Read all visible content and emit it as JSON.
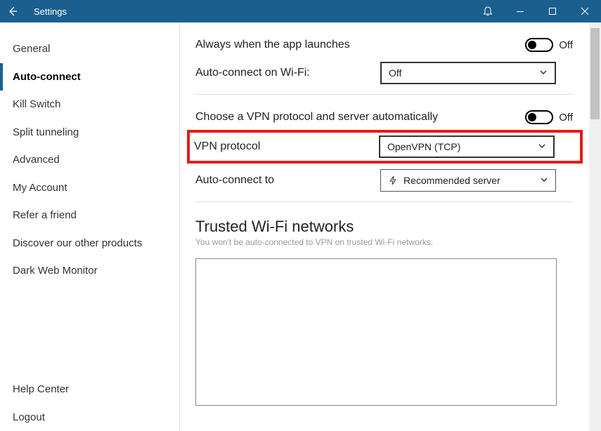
{
  "titlebar": {
    "title": "Settings"
  },
  "sidebar": {
    "items": [
      "General",
      "Auto-connect",
      "Kill Switch",
      "Split tunneling",
      "Advanced",
      "My Account",
      "Refer a friend",
      "Discover our other products",
      "Dark Web Monitor"
    ],
    "active_index": 1,
    "bottom": [
      "Help Center",
      "Logout"
    ]
  },
  "content": {
    "launch_label": "Always when the app launches",
    "launch_toggle": "Off",
    "wifi_label": "Auto-connect on Wi-Fi:",
    "wifi_select": "Off",
    "auto_proto_label": "Choose a VPN protocol and server automatically",
    "auto_proto_toggle": "Off",
    "vpn_proto_label": "VPN protocol",
    "vpn_proto_select": "OpenVPN (TCP)",
    "auto_to_label": "Auto-connect to",
    "auto_to_select": "Recommended server",
    "trusted_title": "Trusted Wi-Fi networks",
    "trusted_sub": "You won't be auto-connected to VPN on trusted Wi-Fi networks."
  }
}
